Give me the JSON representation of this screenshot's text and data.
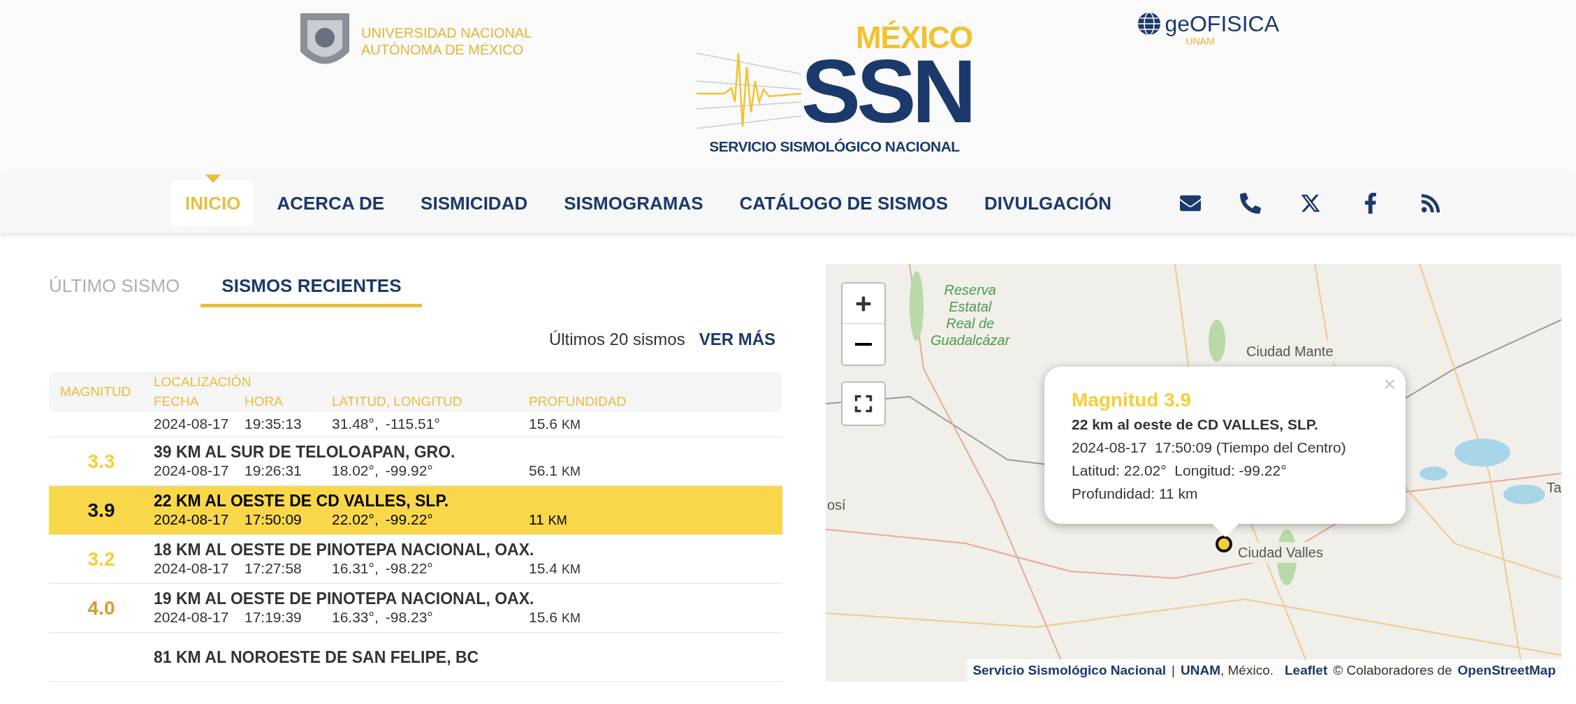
{
  "header": {
    "unam": [
      "UNIVERSIDAD NACIONAL",
      "AUTÓNOMA DE MÉXICO"
    ],
    "ssn": {
      "country": "MÉXICO",
      "acronym": "SSN",
      "name": "SERVICIO SISMOLÓGICO NACIONAL"
    },
    "geofisica": {
      "name": "geOFISICA",
      "sub": "UNAM"
    }
  },
  "nav": {
    "items": [
      {
        "label": "INICIO",
        "selected": true
      },
      {
        "label": "ACERCA DE",
        "selected": false
      },
      {
        "label": "SISMICIDAD",
        "selected": false
      },
      {
        "label": "SISMOGRAMAS",
        "selected": false
      },
      {
        "label": "CATÁLOGO DE SISMOS",
        "selected": false
      },
      {
        "label": "DIVULGACIÓN",
        "selected": false
      }
    ],
    "social": [
      {
        "kind": "mail"
      },
      {
        "kind": "phone"
      },
      {
        "kind": "x"
      },
      {
        "kind": "facebook"
      },
      {
        "kind": "rss"
      }
    ]
  },
  "tabs": [
    {
      "label": "ÚLTIMO SISMO",
      "selected": false
    },
    {
      "label": "SISMOS RECIENTES",
      "selected": true
    }
  ],
  "summary": {
    "text": "Últimos 20 sismos",
    "link": "VER MÁS"
  },
  "table": {
    "columns": {
      "magnitude": "MAGNITUD",
      "location": "LOCALIZACIÓN",
      "date": "FECHA",
      "time": "HORA",
      "coords": "LATITUD, LONGITUD",
      "depth": "PROFUNDIDAD"
    },
    "rows": [
      {
        "date": "2024-08-17",
        "time": "19:35:13",
        "lat": "31.48°,",
        "lon": "-115.51°",
        "depth": "15.6",
        "unit": "KM",
        "selected": false
      },
      {
        "magnitude": "3.3",
        "color": "#f5cf3a",
        "location": "39 KM AL SUR DE TELOLOAPAN, GRO.",
        "date": "2024-08-17",
        "time": "19:26:31",
        "lat": "18.02°,",
        "lon": "-99.92°",
        "depth": "56.1",
        "unit": "KM",
        "selected": false
      },
      {
        "magnitude": "3.9",
        "color": "#111111",
        "location": "22 KM AL OESTE DE CD VALLES, SLP.",
        "date": "2024-08-17",
        "time": "17:50:09",
        "lat": "22.02°,",
        "lon": "-99.22°",
        "depth": "11",
        "unit": "KM",
        "selected": true
      },
      {
        "magnitude": "3.2",
        "color": "#f5cf3a",
        "location": "18 KM AL OESTE DE PINOTEPA NACIONAL, OAX.",
        "date": "2024-08-17",
        "time": "17:27:58",
        "lat": "16.31°,",
        "lon": "-98.22°",
        "depth": "15.4",
        "unit": "KM",
        "selected": false
      },
      {
        "magnitude": "4.0",
        "color": "#d99a2b",
        "location": "19 KM AL OESTE DE PINOTEPA NACIONAL, OAX.",
        "date": "2024-08-17",
        "time": "17:19:39",
        "lat": "16.33°,",
        "lon": "-98.23°",
        "depth": "15.6",
        "unit": "KM",
        "selected": false
      },
      {
        "location": "81 KM AL NOROESTE DE SAN FELIPE, BC",
        "selected": false
      }
    ]
  },
  "map": {
    "labels": [
      {
        "text": "Reserva\nEstatal\nReal de\nGuadalcázar",
        "kind": "park"
      },
      {
        "text": "Ciudad Mante",
        "kind": "city"
      },
      {
        "text": "Ciudad Valles",
        "kind": "city"
      },
      {
        "text": "osí",
        "kind": "city"
      },
      {
        "text": "Ta",
        "kind": "city"
      }
    ],
    "popup": {
      "close": "×",
      "title": "Magnitud 3.9",
      "place": "22 km al oeste de CD VALLES, SLP.",
      "datetime": "2024-08-17  17:50:09 (Tiempo del Centro)",
      "coords": "Latitud: 22.02°  Longitud: -99.22°",
      "depth": "Profundidad: 11 km"
    },
    "attribution": {
      "ssn": "Servicio Sismológico Nacional",
      "sep": "|",
      "unam": "UNAM",
      "rest": ", México.",
      "leaflet": "Leaflet",
      "credit": "© Colaboradores de",
      "osm": "OpenStreetMap"
    }
  }
}
